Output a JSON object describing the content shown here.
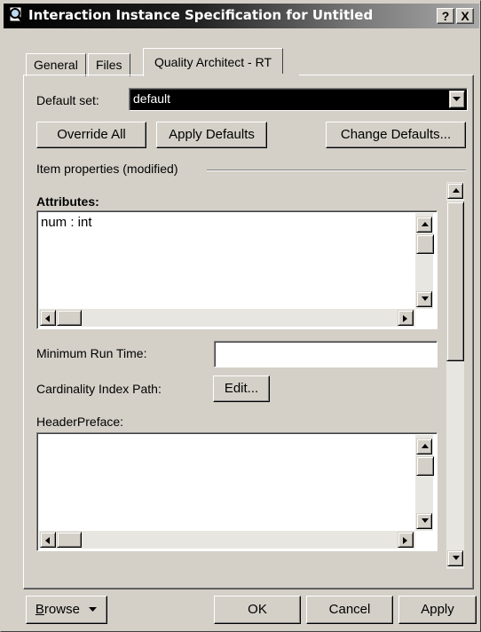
{
  "window": {
    "title": "Interaction Instance Specification for Untitled",
    "help_label": "?",
    "close_label": "X"
  },
  "tabs": [
    {
      "label": "General"
    },
    {
      "label": "Files"
    },
    {
      "label": "Quality Architect - RT"
    }
  ],
  "default_set": {
    "label": "Default set:",
    "value": "default"
  },
  "buttons": {
    "override_all": "Override All",
    "apply_defaults": "Apply Defaults",
    "change_defaults": "Change Defaults..."
  },
  "item_properties": {
    "group_label": "Item properties (modified)"
  },
  "attributes": {
    "label": "Attributes:",
    "value": "num : int"
  },
  "min_run_time": {
    "label": "Minimum Run Time:",
    "value": ""
  },
  "cardinality": {
    "label": "Cardinality Index Path:",
    "edit_label": "Edit..."
  },
  "header_preface": {
    "label": "HeaderPreface:",
    "value": ""
  },
  "footer": {
    "browse_label": "Browse",
    "browse_mnemonic": "B",
    "browse_rest": "rowse",
    "ok_label": "OK",
    "cancel_label": "Cancel",
    "apply_label": "Apply"
  },
  "icons": {
    "title": "magnifier-icon",
    "scroll_up": "arrow-up-icon",
    "scroll_down": "arrow-down-icon",
    "scroll_left": "arrow-left-icon",
    "scroll_right": "arrow-right-icon",
    "dropdown": "chevron-down-icon"
  },
  "colors": {
    "face": "#d4d0c8",
    "title_start": "#000000",
    "title_end": "#a8a8a8",
    "selection": "#000000"
  }
}
